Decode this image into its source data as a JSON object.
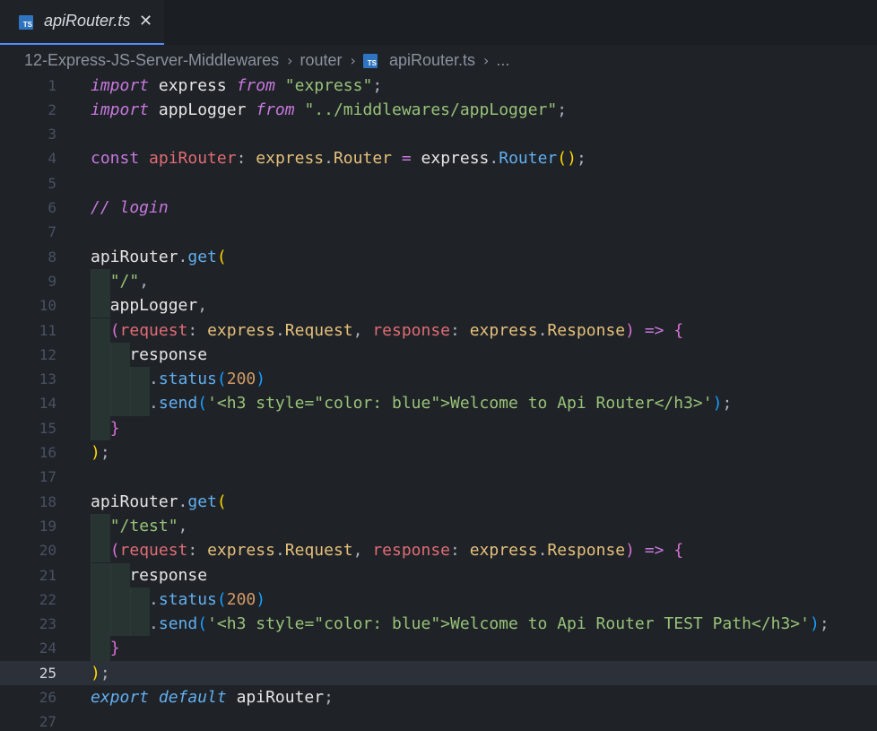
{
  "tab": {
    "icon": "TS",
    "title": "apiRouter.ts",
    "close": "✕"
  },
  "breadcrumb": {
    "folder1": "12-Express-JS-Server-Middlewares",
    "folder2": "router",
    "icon": "TS",
    "file": "apiRouter.ts",
    "more": "...",
    "separator": "›"
  },
  "editor": {
    "current_line": 25,
    "lines": [
      {
        "n": "1",
        "guides": 0,
        "tokens": [
          [
            "kw-i",
            "import"
          ],
          [
            "plain",
            " express "
          ],
          [
            "kw-i",
            "from"
          ],
          [
            "plain",
            " "
          ],
          [
            "str",
            "\"express\""
          ],
          [
            "punc",
            ";"
          ]
        ]
      },
      {
        "n": "2",
        "guides": 0,
        "tokens": [
          [
            "kw-i",
            "import"
          ],
          [
            "plain",
            " appLogger "
          ],
          [
            "kw-i",
            "from"
          ],
          [
            "plain",
            " "
          ],
          [
            "str",
            "\"../middlewares/appLogger\""
          ],
          [
            "punc",
            ";"
          ]
        ]
      },
      {
        "n": "3",
        "guides": 0,
        "tokens": []
      },
      {
        "n": "4",
        "guides": 0,
        "tokens": [
          [
            "kw",
            "const"
          ],
          [
            "plain",
            " "
          ],
          [
            "var",
            "apiRouter"
          ],
          [
            "punc",
            ":"
          ],
          [
            "plain",
            " "
          ],
          [
            "type",
            "express"
          ],
          [
            "punc",
            "."
          ],
          [
            "type",
            "Router"
          ],
          [
            "plain",
            " "
          ],
          [
            "op",
            "="
          ],
          [
            "plain",
            " express"
          ],
          [
            "punc",
            "."
          ],
          [
            "fn",
            "Router"
          ],
          [
            "b1",
            "()"
          ],
          [
            "punc",
            ";"
          ]
        ]
      },
      {
        "n": "5",
        "guides": 0,
        "tokens": []
      },
      {
        "n": "6",
        "guides": 0,
        "tokens": [
          [
            "cmt",
            "// login"
          ]
        ]
      },
      {
        "n": "7",
        "guides": 0,
        "tokens": []
      },
      {
        "n": "8",
        "guides": 0,
        "tokens": [
          [
            "plain",
            "apiRouter"
          ],
          [
            "punc",
            "."
          ],
          [
            "fn",
            "get"
          ],
          [
            "b1",
            "("
          ]
        ]
      },
      {
        "n": "9",
        "guides": 1,
        "tokens": [
          [
            "plain",
            "  "
          ],
          [
            "str",
            "\"/\""
          ],
          [
            "punc",
            ","
          ]
        ]
      },
      {
        "n": "10",
        "guides": 1,
        "tokens": [
          [
            "plain",
            "  appLogger"
          ],
          [
            "punc",
            ","
          ]
        ]
      },
      {
        "n": "11",
        "guides": 1,
        "tokens": [
          [
            "plain",
            "  "
          ],
          [
            "b2",
            "("
          ],
          [
            "var",
            "request"
          ],
          [
            "punc",
            ":"
          ],
          [
            "plain",
            " "
          ],
          [
            "type",
            "express"
          ],
          [
            "punc",
            "."
          ],
          [
            "type",
            "Request"
          ],
          [
            "punc",
            ","
          ],
          [
            "plain",
            " "
          ],
          [
            "var",
            "response"
          ],
          [
            "punc",
            ":"
          ],
          [
            "plain",
            " "
          ],
          [
            "type",
            "express"
          ],
          [
            "punc",
            "."
          ],
          [
            "type",
            "Response"
          ],
          [
            "b2",
            ")"
          ],
          [
            "plain",
            " "
          ],
          [
            "op",
            "=>"
          ],
          [
            "plain",
            " "
          ],
          [
            "b2",
            "{"
          ]
        ]
      },
      {
        "n": "12",
        "guides": 2,
        "tokens": [
          [
            "plain",
            "    response"
          ]
        ]
      },
      {
        "n": "13",
        "guides": 3,
        "tokens": [
          [
            "plain",
            "      "
          ],
          [
            "punc",
            "."
          ],
          [
            "fn",
            "status"
          ],
          [
            "b3",
            "("
          ],
          [
            "num",
            "200"
          ],
          [
            "b3",
            ")"
          ]
        ]
      },
      {
        "n": "14",
        "guides": 3,
        "tokens": [
          [
            "plain",
            "      "
          ],
          [
            "punc",
            "."
          ],
          [
            "fn",
            "send"
          ],
          [
            "b3",
            "("
          ],
          [
            "str",
            "'<h3 style=\"color: blue\">Welcome to Api Router</h3>'"
          ],
          [
            "b3",
            ")"
          ],
          [
            "punc",
            ";"
          ]
        ]
      },
      {
        "n": "15",
        "guides": 1,
        "tokens": [
          [
            "plain",
            "  "
          ],
          [
            "b2",
            "}"
          ]
        ]
      },
      {
        "n": "16",
        "guides": 0,
        "tokens": [
          [
            "b1",
            ")"
          ],
          [
            "punc",
            ";"
          ]
        ]
      },
      {
        "n": "17",
        "guides": 0,
        "tokens": []
      },
      {
        "n": "18",
        "guides": 0,
        "tokens": [
          [
            "plain",
            "apiRouter"
          ],
          [
            "punc",
            "."
          ],
          [
            "fn",
            "get"
          ],
          [
            "b1",
            "("
          ]
        ]
      },
      {
        "n": "19",
        "guides": 1,
        "tokens": [
          [
            "plain",
            "  "
          ],
          [
            "str",
            "\"/test\""
          ],
          [
            "punc",
            ","
          ]
        ]
      },
      {
        "n": "20",
        "guides": 1,
        "tokens": [
          [
            "plain",
            "  "
          ],
          [
            "b2",
            "("
          ],
          [
            "var",
            "request"
          ],
          [
            "punc",
            ":"
          ],
          [
            "plain",
            " "
          ],
          [
            "type",
            "express"
          ],
          [
            "punc",
            "."
          ],
          [
            "type",
            "Request"
          ],
          [
            "punc",
            ","
          ],
          [
            "plain",
            " "
          ],
          [
            "var",
            "response"
          ],
          [
            "punc",
            ":"
          ],
          [
            "plain",
            " "
          ],
          [
            "type",
            "express"
          ],
          [
            "punc",
            "."
          ],
          [
            "type",
            "Response"
          ],
          [
            "b2",
            ")"
          ],
          [
            "plain",
            " "
          ],
          [
            "op",
            "=>"
          ],
          [
            "plain",
            " "
          ],
          [
            "b2",
            "{"
          ]
        ]
      },
      {
        "n": "21",
        "guides": 2,
        "tokens": [
          [
            "plain",
            "    response"
          ]
        ]
      },
      {
        "n": "22",
        "guides": 3,
        "tokens": [
          [
            "plain",
            "      "
          ],
          [
            "punc",
            "."
          ],
          [
            "fn",
            "status"
          ],
          [
            "b3",
            "("
          ],
          [
            "num",
            "200"
          ],
          [
            "b3",
            ")"
          ]
        ]
      },
      {
        "n": "23",
        "guides": 3,
        "tokens": [
          [
            "plain",
            "      "
          ],
          [
            "punc",
            "."
          ],
          [
            "fn",
            "send"
          ],
          [
            "b3",
            "("
          ],
          [
            "str",
            "'<h3 style=\"color: blue\">Welcome to Api Router TEST Path</h3>'"
          ],
          [
            "b3",
            ")"
          ],
          [
            "punc",
            ";"
          ]
        ]
      },
      {
        "n": "24",
        "guides": 1,
        "tokens": [
          [
            "plain",
            "  "
          ],
          [
            "b2",
            "}"
          ]
        ]
      },
      {
        "n": "25",
        "guides": 0,
        "tokens": [
          [
            "b1",
            ")"
          ],
          [
            "punc",
            ";"
          ]
        ]
      },
      {
        "n": "26",
        "guides": 0,
        "tokens": [
          [
            "kw-ib",
            "export"
          ],
          [
            "plain",
            " "
          ],
          [
            "kw-ib",
            "default"
          ],
          [
            "plain",
            " apiRouter"
          ],
          [
            "punc",
            ";"
          ]
        ]
      },
      {
        "n": "27",
        "guides": 0,
        "tokens": []
      }
    ]
  }
}
